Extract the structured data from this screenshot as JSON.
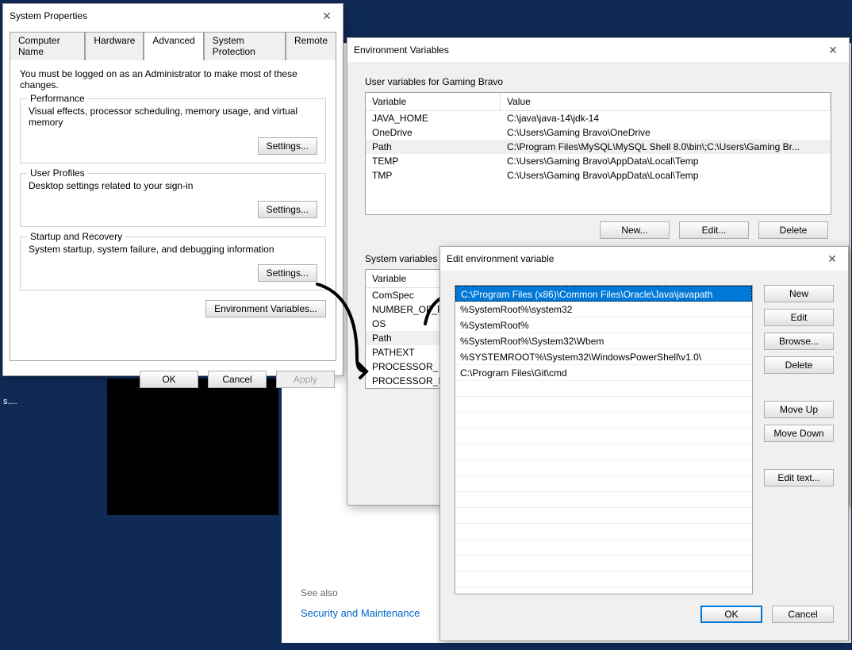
{
  "sysprops": {
    "title": "System Properties",
    "tabs": {
      "computer": "Computer Name",
      "hardware": "Hardware",
      "advanced": "Advanced",
      "protection": "System Protection",
      "remote": "Remote"
    },
    "admin_note": "You must be logged on as an Administrator to make most of these changes.",
    "perf": {
      "legend": "Performance",
      "desc": "Visual effects, processor scheduling, memory usage, and virtual memory",
      "btn": "Settings..."
    },
    "prof": {
      "legend": "User Profiles",
      "desc": "Desktop settings related to your sign-in",
      "btn": "Settings..."
    },
    "startup": {
      "legend": "Startup and Recovery",
      "desc": "System startup, system failure, and debugging information",
      "btn": "Settings..."
    },
    "envbtn": "Environment Variables...",
    "ok": "OK",
    "cancel": "Cancel",
    "apply": "Apply"
  },
  "env": {
    "title": "Environment Variables",
    "user_label": "User variables for Gaming Bravo",
    "cols": {
      "var": "Variable",
      "val": "Value"
    },
    "user_rows": [
      {
        "var": "JAVA_HOME",
        "val": "C:\\java\\java-14\\jdk-14"
      },
      {
        "var": "OneDrive",
        "val": "C:\\Users\\Gaming Bravo\\OneDrive"
      },
      {
        "var": "Path",
        "val": "C:\\Program Files\\MySQL\\MySQL Shell 8.0\\bin\\;C:\\Users\\Gaming Br..."
      },
      {
        "var": "TEMP",
        "val": "C:\\Users\\Gaming Bravo\\AppData\\Local\\Temp"
      },
      {
        "var": "TMP",
        "val": "C:\\Users\\Gaming Bravo\\AppData\\Local\\Temp"
      }
    ],
    "btns": {
      "new": "New...",
      "edit": "Edit...",
      "delete": "Delete"
    },
    "sys_label": "System variables",
    "sys_rows": [
      {
        "var": "ComSpec"
      },
      {
        "var": "NUMBER_OF_PR"
      },
      {
        "var": "OS"
      },
      {
        "var": "Path"
      },
      {
        "var": "PATHEXT"
      },
      {
        "var": "PROCESSOR_ARC"
      },
      {
        "var": "PROCESSOR_IDE"
      }
    ]
  },
  "edit": {
    "title": "Edit environment variable",
    "rows": [
      "C:\\Program Files (x86)\\Common Files\\Oracle\\Java\\javapath",
      "%SystemRoot%\\system32",
      "%SystemRoot%",
      "%SystemRoot%\\System32\\Wbem",
      "%SYSTEMROOT%\\System32\\WindowsPowerShell\\v1.0\\",
      "C:\\Program Files\\Git\\cmd"
    ],
    "btns": {
      "new": "New",
      "edit": "Edit",
      "browse": "Browse...",
      "delete": "Delete",
      "moveup": "Move Up",
      "movedown": "Move Down",
      "edittext": "Edit text..."
    },
    "ok": "OK",
    "cancel": "Cancel"
  },
  "misc": {
    "seealso": "See also",
    "secmaint": "Security and Maintenance",
    "desktop_s": "s...."
  }
}
